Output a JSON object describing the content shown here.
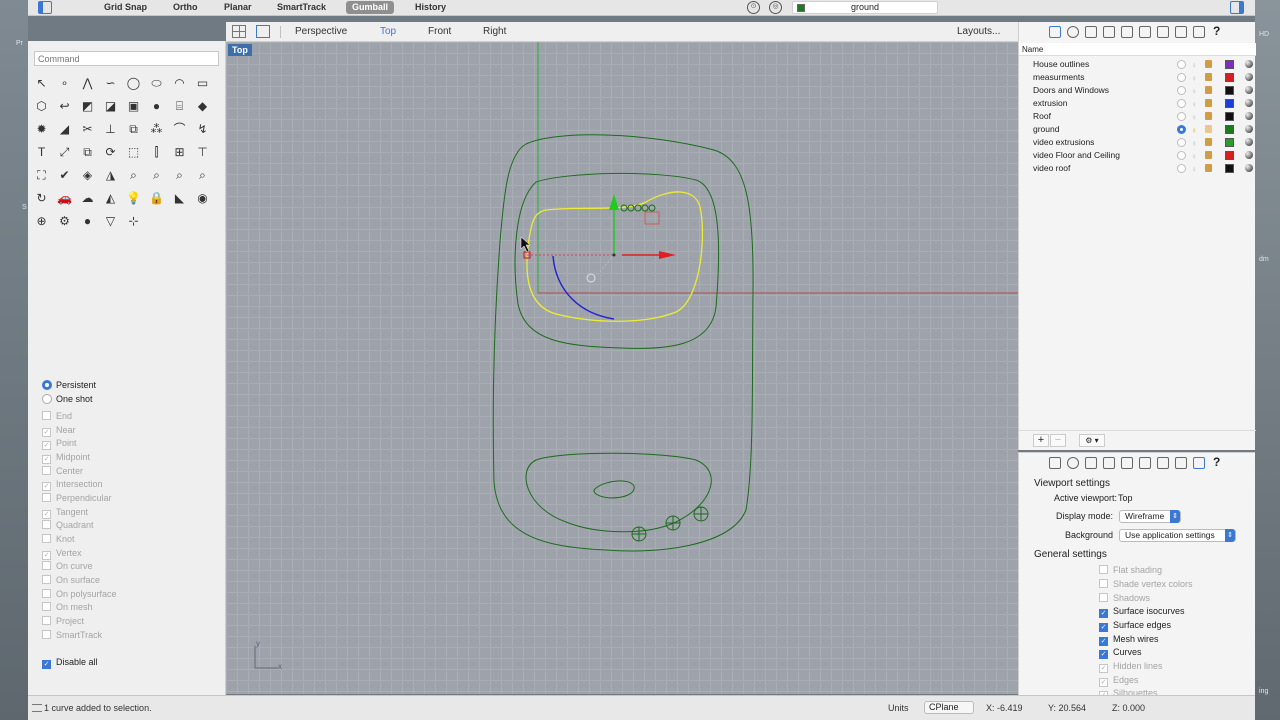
{
  "desktop": {
    "left_labels": [
      "Pr",
      "S"
    ],
    "right_labels": [
      "HD",
      "dm",
      "ing"
    ]
  },
  "toolbar": {
    "toggles": [
      {
        "label": "Grid Snap",
        "on": false
      },
      {
        "label": "Ortho",
        "on": false
      },
      {
        "label": "Planar",
        "on": false
      },
      {
        "label": "SmartTrack",
        "on": false
      },
      {
        "label": "Gumball",
        "on": true
      },
      {
        "label": "History",
        "on": false
      }
    ],
    "current_layer": "ground",
    "current_layer_color": "#1e7a1e"
  },
  "command": {
    "placeholder": "Command"
  },
  "viewport_tabs": {
    "items": [
      "Perspective",
      "Top",
      "Front",
      "Right"
    ],
    "active": "Top",
    "layouts": "Layouts..."
  },
  "viewport": {
    "label": "Top",
    "axis_x": "x",
    "axis_y": "y"
  },
  "osnap": {
    "modes": [
      {
        "label": "Persistent",
        "on": true
      },
      {
        "label": "One shot",
        "on": false
      }
    ],
    "items": [
      {
        "label": "End",
        "checked": false
      },
      {
        "label": "Near",
        "checked": true
      },
      {
        "label": "Point",
        "checked": true
      },
      {
        "label": "Midpoint",
        "checked": true
      },
      {
        "label": "Center",
        "checked": false
      },
      {
        "label": "Intersection",
        "checked": true
      },
      {
        "label": "Perpendicular",
        "checked": false
      },
      {
        "label": "Tangent",
        "checked": true
      },
      {
        "label": "Quadrant",
        "checked": false
      },
      {
        "label": "Knot",
        "checked": false
      },
      {
        "label": "Vertex",
        "checked": true
      },
      {
        "label": "On curve",
        "checked": false
      },
      {
        "label": "On surface",
        "checked": false
      },
      {
        "label": "On polysurface",
        "checked": false
      },
      {
        "label": "On mesh",
        "checked": false
      },
      {
        "label": "Project",
        "checked": false
      },
      {
        "label": "SmartTrack",
        "checked": false
      }
    ],
    "disable_all": "Disable all"
  },
  "layers": {
    "header": "Name",
    "items": [
      {
        "name": "House outlines",
        "color": "#7b2fbe",
        "current": false
      },
      {
        "name": "measurments",
        "color": "#d62020",
        "current": false
      },
      {
        "name": "Doors and Windows",
        "color": "#111111",
        "current": false
      },
      {
        "name": "extrusion",
        "color": "#1e3fd6",
        "current": false
      },
      {
        "name": "Roof",
        "color": "#111111",
        "current": false
      },
      {
        "name": "ground",
        "color": "#1e7a1e",
        "current": true
      },
      {
        "name": "video extrusions",
        "color": "#2c9b2c",
        "current": false
      },
      {
        "name": "video Floor and Ceiling",
        "color": "#d62020",
        "current": false
      },
      {
        "name": "video roof",
        "color": "#111111",
        "current": false
      }
    ],
    "add": "+",
    "remove": "−",
    "gear": "⚙ ▾"
  },
  "properties": {
    "viewport_title": "Viewport settings",
    "active_label": "Active viewport:",
    "active_value": "Top",
    "display_label": "Display mode:",
    "display_value": "Wireframe",
    "background_label": "Background",
    "background_value": "Use application settings",
    "general_title": "General settings",
    "general": [
      {
        "label": "Flat shading",
        "checked": false,
        "enabled": false
      },
      {
        "label": "Shade vertex colors",
        "checked": false,
        "enabled": false
      },
      {
        "label": "Shadows",
        "checked": false,
        "enabled": false
      },
      {
        "label": "Surface isocurves",
        "checked": true,
        "enabled": true
      },
      {
        "label": "Surface edges",
        "checked": true,
        "enabled": true
      },
      {
        "label": "Mesh wires",
        "checked": true,
        "enabled": true
      },
      {
        "label": "Curves",
        "checked": true,
        "enabled": true
      },
      {
        "label": "Hidden lines",
        "checked": true,
        "enabled": false
      },
      {
        "label": "Edges",
        "checked": true,
        "enabled": false
      },
      {
        "label": "Silhouettes",
        "checked": true,
        "enabled": false
      }
    ]
  },
  "status": {
    "message": "1 curve added to selection.",
    "units": "Units",
    "cplane": "CPlane",
    "x": "X: -6.419",
    "y": "Y: 20.564",
    "z": "Z: 0.000"
  }
}
